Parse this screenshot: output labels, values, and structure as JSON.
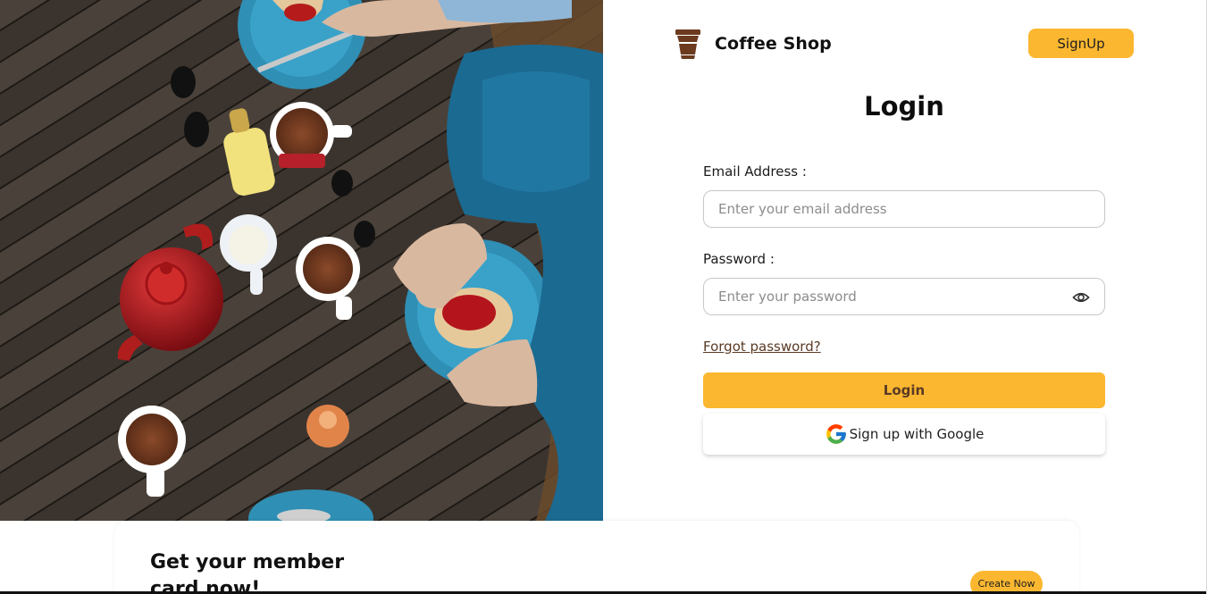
{
  "brand": {
    "name": "Coffee Shop",
    "logo_icon": "coffee-cup-icon",
    "color": "#6b3a1f"
  },
  "header": {
    "signup_label": "SignUp"
  },
  "login": {
    "title": "Login",
    "email_label": "Email Address :",
    "email_placeholder": "Enter your email address",
    "email_value": "",
    "password_label": "Password :",
    "password_placeholder": "Enter your password",
    "password_value": "",
    "password_toggle_icon": "eye-icon",
    "forgot_label": "Forgot password?",
    "submit_label": "Login",
    "google_label": "Sign up with Google",
    "google_icon": "google-icon"
  },
  "member_card": {
    "title": "Get your member card now!",
    "cta_label": "Create Now"
  },
  "colors": {
    "accent": "#fbb730",
    "brand_brown": "#5a3a24",
    "text_dark": "#111111",
    "field_border": "#c8c8c8"
  }
}
